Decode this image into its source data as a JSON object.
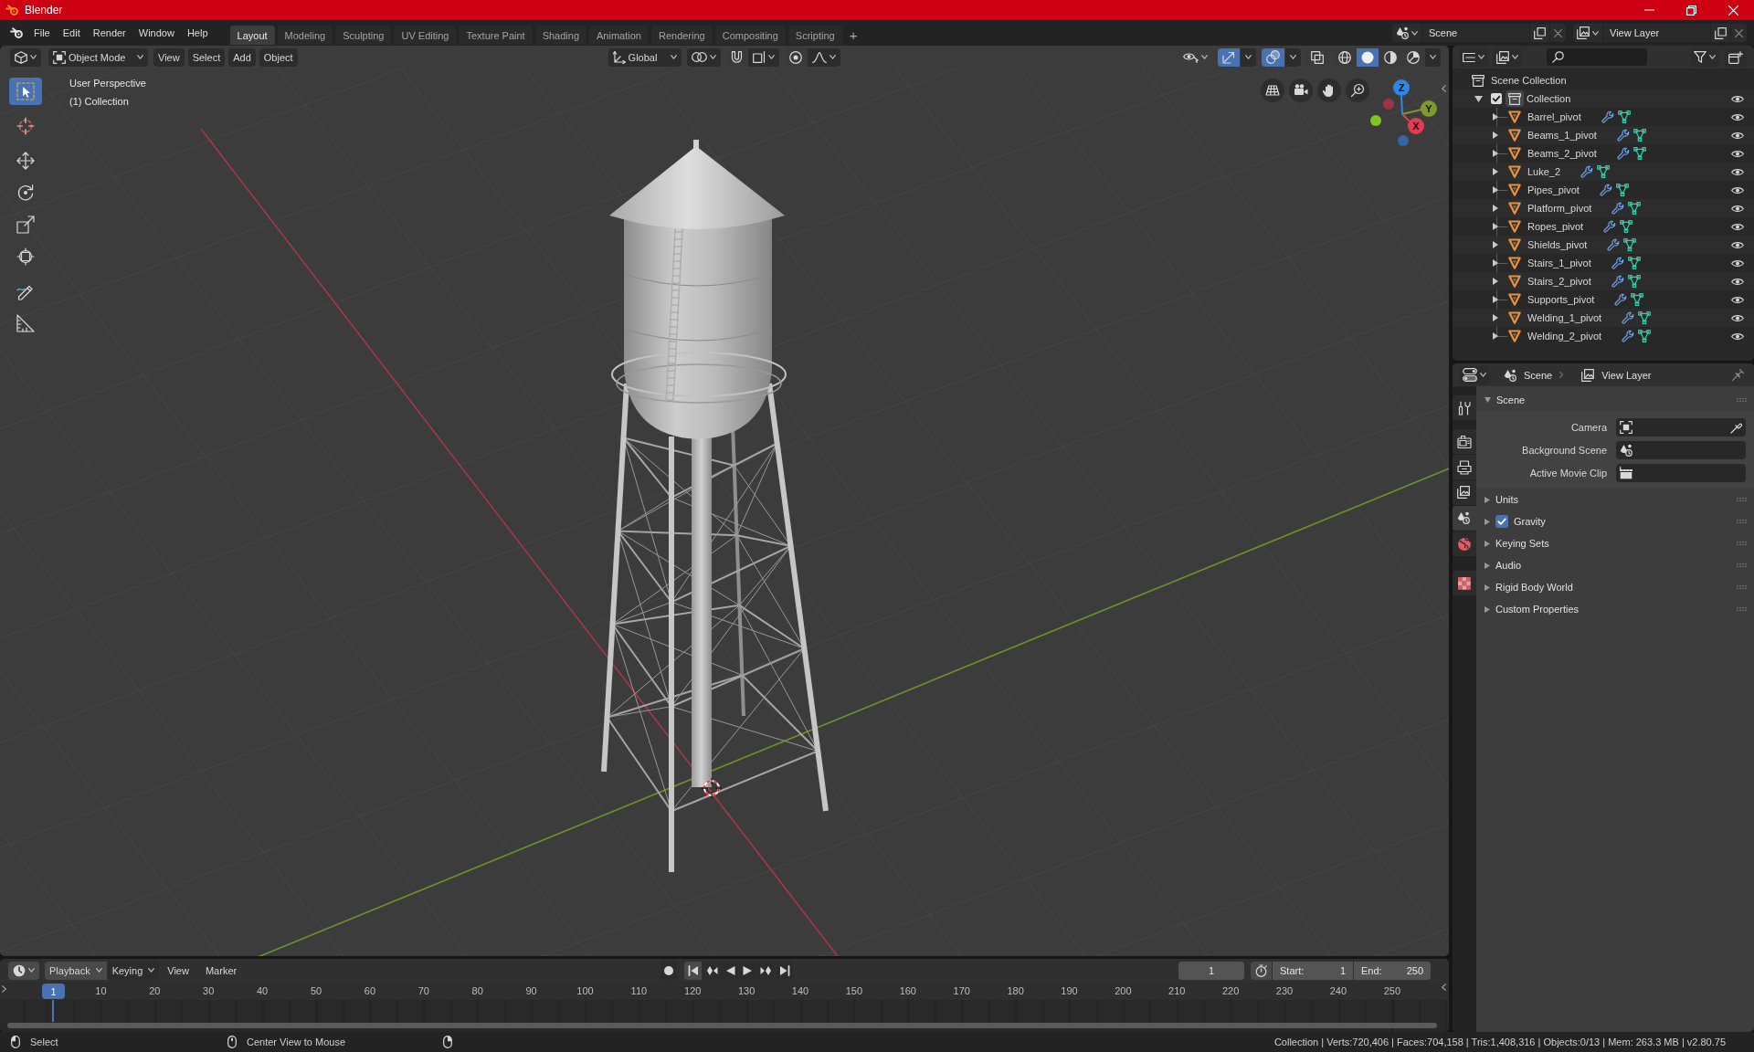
{
  "window": {
    "title": "Blender"
  },
  "menu": [
    "File",
    "Edit",
    "Render",
    "Window",
    "Help"
  ],
  "workspaces": [
    {
      "label": "Layout",
      "selected": true
    },
    {
      "label": "Modeling",
      "selected": false
    },
    {
      "label": "Sculpting",
      "selected": false
    },
    {
      "label": "UV Editing",
      "selected": false
    },
    {
      "label": "Texture Paint",
      "selected": false
    },
    {
      "label": "Shading",
      "selected": false
    },
    {
      "label": "Animation",
      "selected": false
    },
    {
      "label": "Rendering",
      "selected": false
    },
    {
      "label": "Compositing",
      "selected": false
    },
    {
      "label": "Scripting",
      "selected": false
    }
  ],
  "add_workspace": "+",
  "scene": "Scene",
  "view_layer": "View Layer",
  "viewport": {
    "mode": "Object Mode",
    "menus": [
      "View",
      "Select",
      "Add",
      "Object"
    ],
    "orientation": "Global",
    "gizmos_on": true,
    "overlays_on": true,
    "xray_on": false,
    "shading": [
      {
        "kind": "wireframe",
        "selected": false
      },
      {
        "kind": "solid",
        "selected": true
      },
      {
        "kind": "material",
        "selected": false
      },
      {
        "kind": "rendered",
        "selected": false
      }
    ],
    "info": [
      "User Perspective",
      "(1) Collection"
    ],
    "tool_groups": [
      [
        {
          "kind": "select-box",
          "selected": true
        }
      ],
      [
        {
          "kind": "cursor",
          "selected": false
        }
      ],
      [
        {
          "kind": "move",
          "selected": false
        },
        {
          "kind": "rotate",
          "selected": false
        },
        {
          "kind": "scale",
          "selected": false
        },
        {
          "kind": "transform",
          "selected": false
        }
      ],
      [
        {
          "kind": "annotate",
          "selected": false
        },
        {
          "kind": "measure",
          "selected": false
        }
      ]
    ],
    "gizmo": {
      "x": "X",
      "y": "Y",
      "z": "Z"
    }
  },
  "outliner": {
    "root": "Scene Collection",
    "collections": [
      {
        "name": "Collection",
        "checked": true,
        "expanded": true,
        "visible": true,
        "children": [
          {
            "name": "Barrel_pivot",
            "expanded": false,
            "visible": true
          },
          {
            "name": "Beams_1_pivot",
            "expanded": false,
            "visible": true
          },
          {
            "name": "Beams_2_pivot",
            "expanded": false,
            "visible": true
          },
          {
            "name": "Luke_2",
            "expanded": false,
            "visible": true
          },
          {
            "name": "Pipes_pivot",
            "expanded": false,
            "visible": true
          },
          {
            "name": "Platform_pivot",
            "expanded": false,
            "visible": true
          },
          {
            "name": "Ropes_pivot",
            "expanded": false,
            "visible": true
          },
          {
            "name": "Shields_pivot",
            "expanded": false,
            "visible": true
          },
          {
            "name": "Stairs_1_pivot",
            "expanded": false,
            "visible": true
          },
          {
            "name": "Stairs_2_pivot",
            "expanded": false,
            "visible": true
          },
          {
            "name": "Supports_pivot",
            "expanded": false,
            "visible": true
          },
          {
            "name": "Welding_1_pivot",
            "expanded": false,
            "visible": true
          },
          {
            "name": "Welding_2_pivot",
            "expanded": false,
            "visible": true
          }
        ]
      }
    ]
  },
  "properties": {
    "context": [
      "Scene",
      "View Layer"
    ],
    "tab_groups": [
      [
        {
          "kind": "tool",
          "selected": false
        }
      ],
      [
        {
          "kind": "render",
          "selected": false
        },
        {
          "kind": "output",
          "selected": false
        },
        {
          "kind": "view-layer",
          "selected": false
        },
        {
          "kind": "scene",
          "selected": true
        },
        {
          "kind": "world",
          "selected": false
        }
      ],
      [
        {
          "kind": "texture",
          "selected": false
        }
      ]
    ],
    "panels": [
      {
        "title": "Scene",
        "expanded": true,
        "fields": [
          {
            "label": "Camera",
            "kind": "camera"
          },
          {
            "label": "Background Scene",
            "kind": "scene"
          },
          {
            "label": "Active Movie Clip",
            "kind": "clip"
          }
        ]
      },
      {
        "title": "Units",
        "expanded": false
      },
      {
        "title": "Gravity",
        "expanded": false,
        "checkbox": {
          "checked": true
        }
      },
      {
        "title": "Keying Sets",
        "expanded": false
      },
      {
        "title": "Audio",
        "expanded": false
      },
      {
        "title": "Rigid Body World",
        "expanded": false
      },
      {
        "title": "Custom Properties",
        "expanded": false
      }
    ]
  },
  "timeline": {
    "menus": [
      {
        "label": "Playback",
        "kind": "dropdown"
      },
      {
        "label": "Keying",
        "kind": "dropdown"
      },
      {
        "label": "View",
        "kind": "menu"
      },
      {
        "label": "Marker",
        "kind": "menu"
      }
    ],
    "current_frame": "1",
    "start_label": "Start:",
    "start": "1",
    "end_label": "End:",
    "end": "250",
    "playhead": "1",
    "ruler": [
      "10",
      "20",
      "30",
      "40",
      "50",
      "60",
      "70",
      "80",
      "90",
      "100",
      "110",
      "120",
      "130",
      "140",
      "150",
      "160",
      "170",
      "180",
      "190",
      "200",
      "210",
      "220",
      "230",
      "240",
      "250"
    ]
  },
  "status_bar": {
    "hints": [
      {
        "kind": "left-click",
        "text": "Select"
      },
      {
        "kind": "middle-click",
        "text": "Center View to Mouse"
      },
      {
        "kind": "right-click"
      }
    ],
    "stats": "Collection | Verts:720,406 | Faces:704,158 | Tris:1,408,316 | Objects:0/13 | Mem: 263.3 MB | v2.80.75"
  }
}
